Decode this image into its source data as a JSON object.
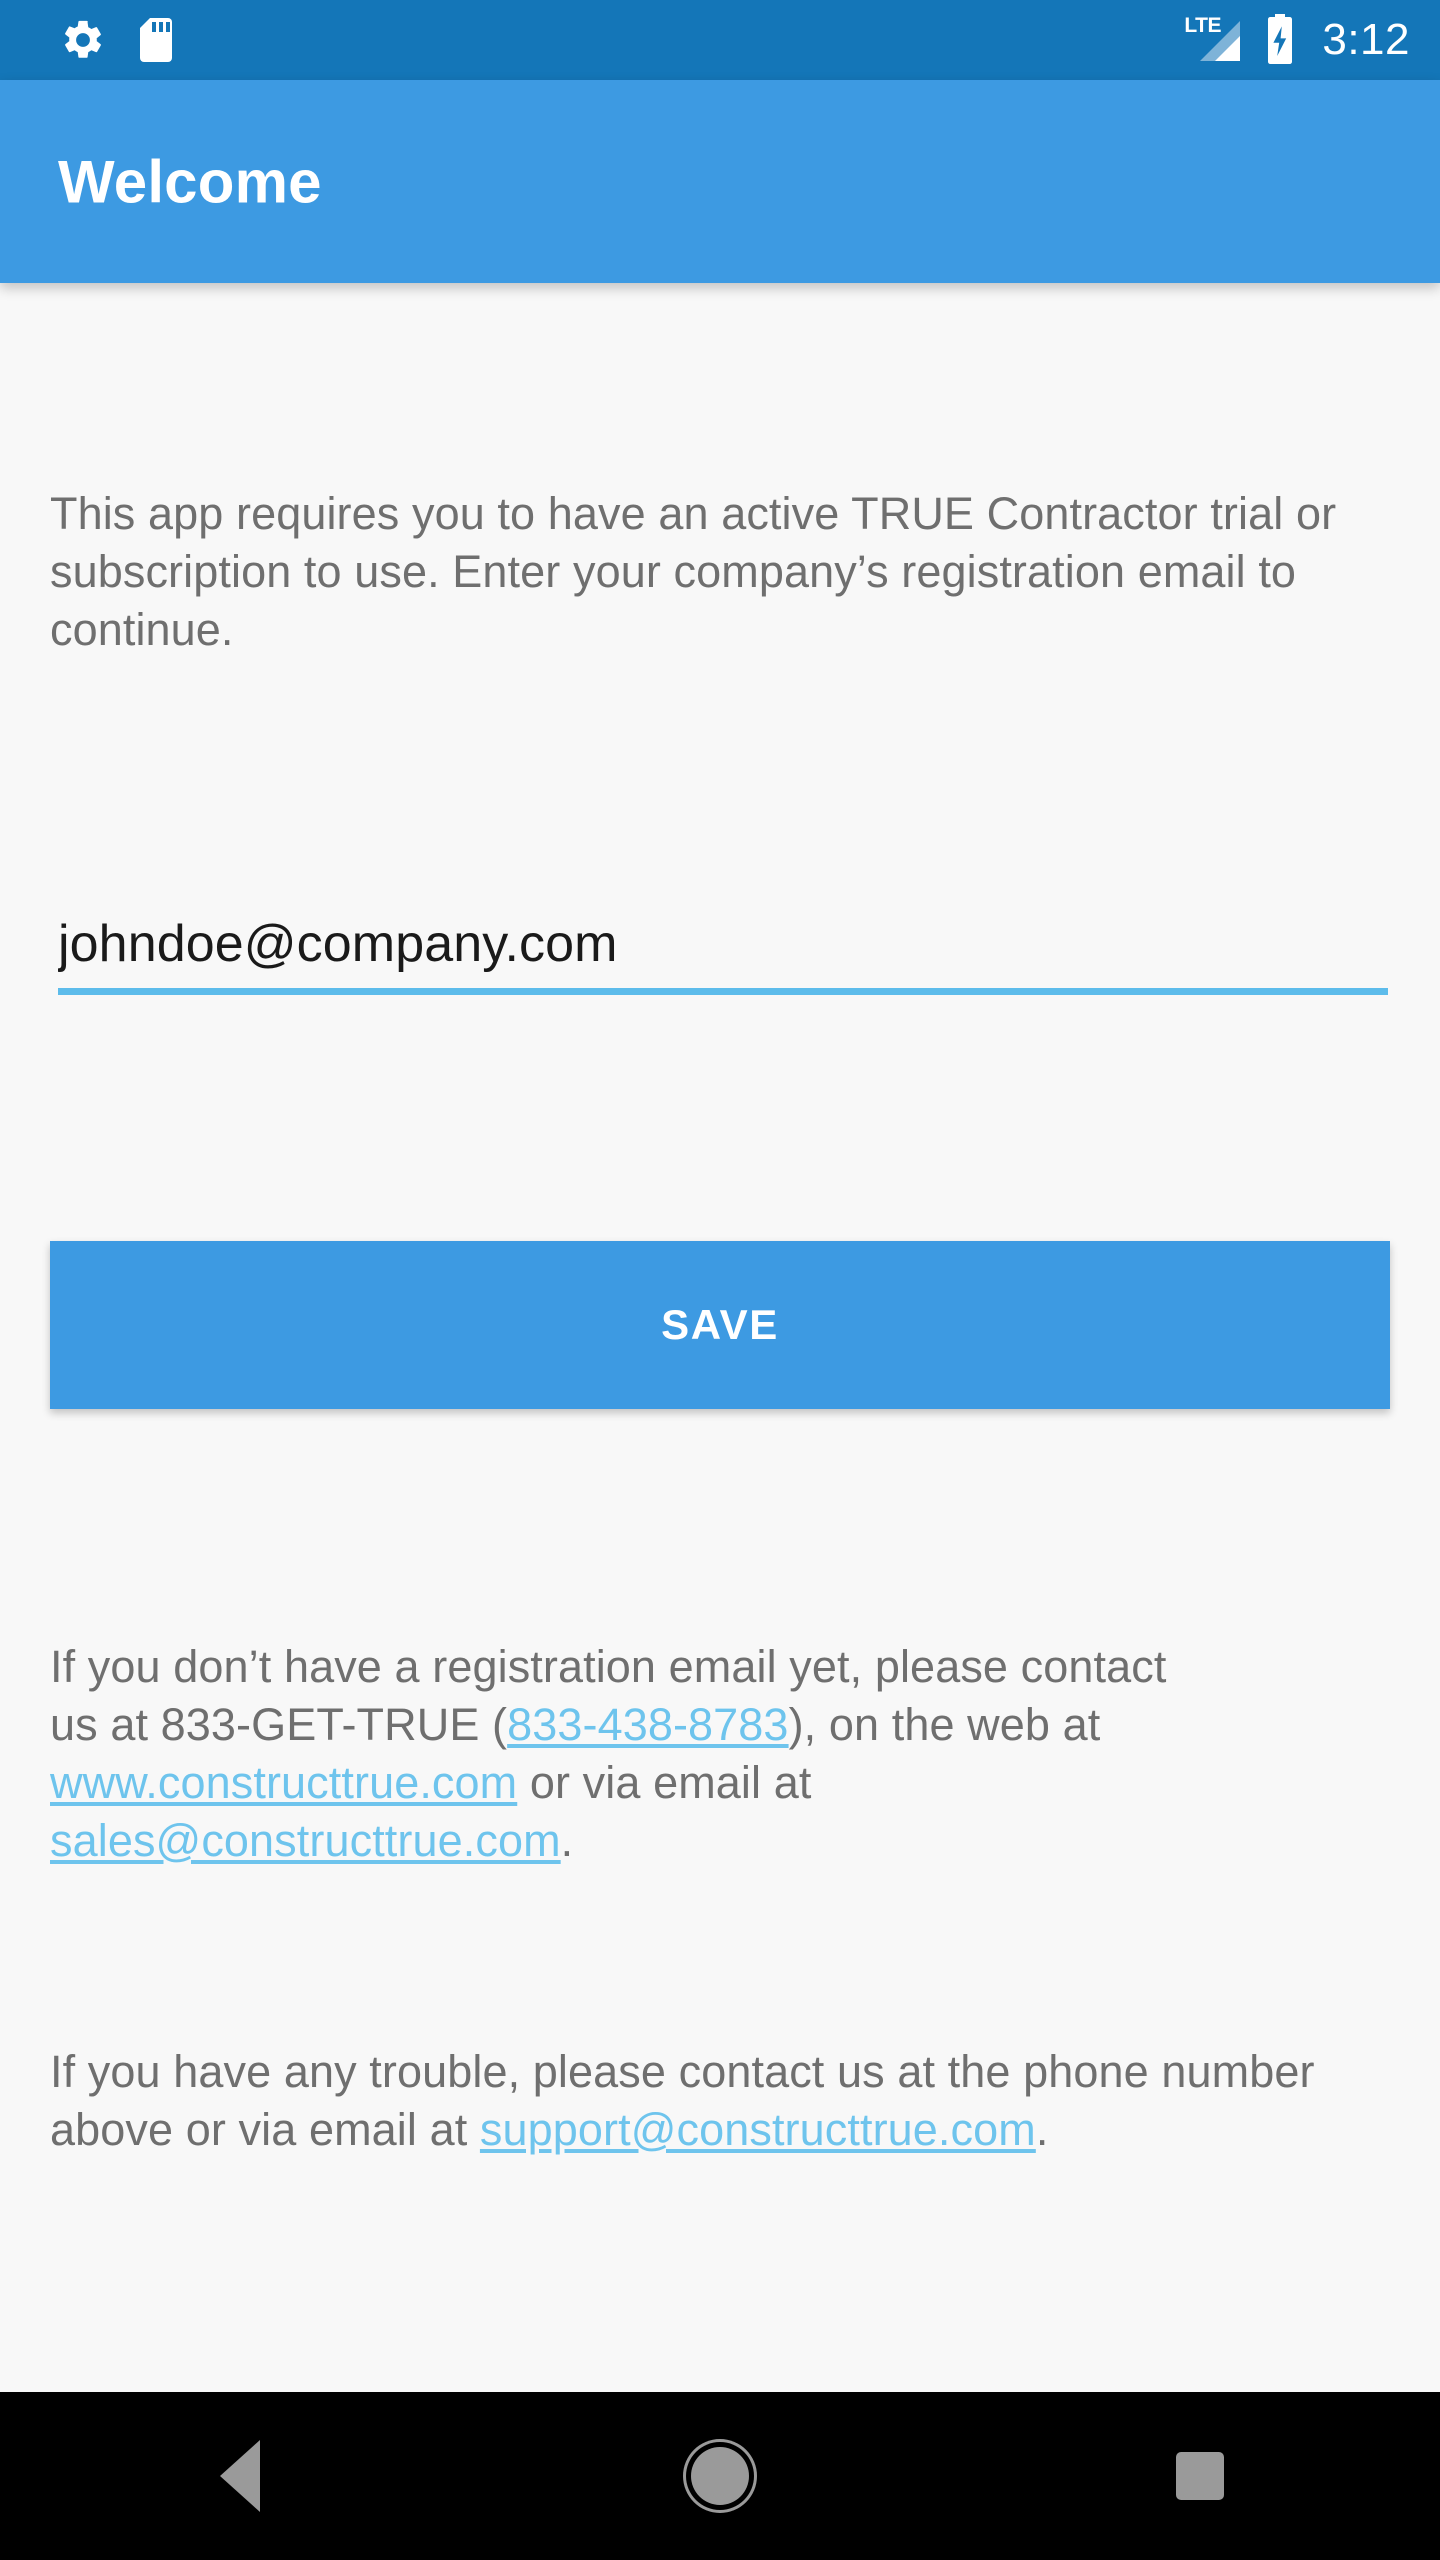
{
  "status_bar": {
    "icons": [
      "gear-icon",
      "sd-card-icon"
    ],
    "network_label": "LTE",
    "signal": "signal-bars-icon",
    "battery": "battery-charging-icon",
    "time": "3:12",
    "background_color": "#1476b8",
    "foreground_color": "#ffffff"
  },
  "app_bar": {
    "title": "Welcome",
    "background_color": "#3d9ae2",
    "title_color": "#ffffff"
  },
  "content": {
    "background_color": "#f8f8f8",
    "text_color": "#6f6f6f",
    "link_color": "#6ec4ed",
    "intro_text": "This app requires you to have an active TRUE Contractor trial or subscription to use. Enter your company’s registration email to continue.",
    "email_field": {
      "value": "johndoe@company.com",
      "placeholder": "Registration email",
      "underline_color": "#5dbceb"
    },
    "save_button": {
      "label": "SAVE",
      "background_color": "#3d9ae2",
      "text_color": "#ffffff"
    },
    "contact_paragraph": {
      "part1": "If you don’t have a registration email yet, please contact us at 833-GET-TRUE (",
      "phone_link": "833-438-8783",
      "part2": "), on the web at ",
      "web_link": "www.constructtrue.com",
      "part3": " or via email at ",
      "email_link": "sales@constructtrue.com",
      "part4": "."
    },
    "trouble_paragraph": {
      "part1": "If you have any trouble, please contact us at the phone number above or via email at ",
      "support_link": "support@constructtrue.com",
      "part2": "."
    }
  },
  "nav_bar": {
    "background_color": "#000000",
    "icon_color": "#9a9a9a",
    "buttons": [
      {
        "name": "back",
        "icon": "triangle-back-icon"
      },
      {
        "name": "home",
        "icon": "circle-home-icon"
      },
      {
        "name": "recents",
        "icon": "square-recents-icon"
      }
    ]
  }
}
